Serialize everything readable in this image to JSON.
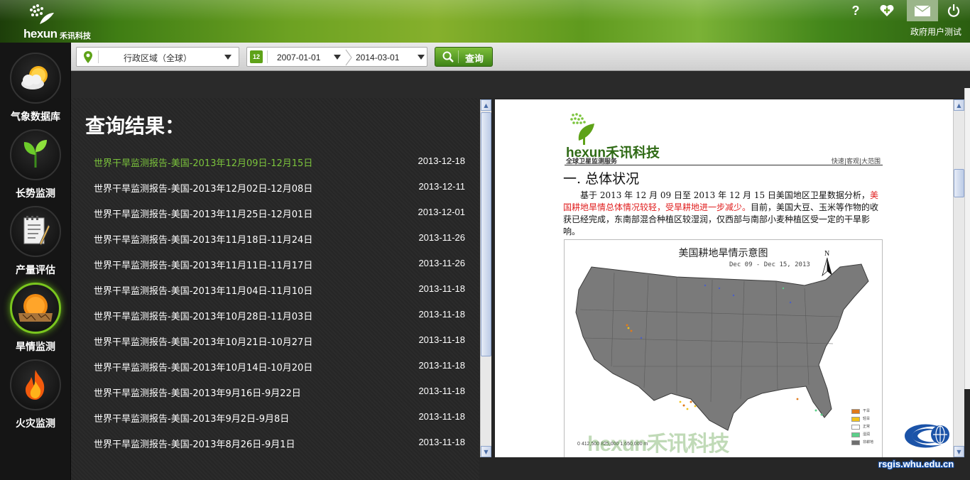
{
  "header": {
    "logo_text": "hexun",
    "logo_cn": "禾讯科技",
    "help_label": "?",
    "username": "政府用户测试"
  },
  "sidebar": {
    "items": [
      {
        "label": "气象数据库",
        "icon": "weather-icon"
      },
      {
        "label": "长势监测",
        "icon": "sprout-icon"
      },
      {
        "label": "产量评估",
        "icon": "notepad-icon"
      },
      {
        "label": "旱情监测",
        "icon": "drought-icon",
        "active": true
      },
      {
        "label": "火灾监测",
        "icon": "fire-icon"
      }
    ]
  },
  "toolbar": {
    "region_value": "行政区域（全球）",
    "start_date": "2007-01-01",
    "end_date": "2014-03-01",
    "calendar_day": "12",
    "query_label": "查询"
  },
  "results": {
    "title": "查询结果：",
    "rows": [
      {
        "title": "世界干旱监测报告-美国-2013年12月09日-12月15日",
        "date": "2013-12-18",
        "selected": true
      },
      {
        "title": "世界干旱监测报告-美国-2013年12月02日-12月08日",
        "date": "2013-12-11"
      },
      {
        "title": "世界干旱监测报告-美国-2013年11月25日-12月01日",
        "date": "2013-12-01"
      },
      {
        "title": "世界干旱监测报告-美国-2013年11月18日-11月24日",
        "date": "2013-11-26"
      },
      {
        "title": "世界干旱监测报告-美国-2013年11月11日-11月17日",
        "date": "2013-11-26"
      },
      {
        "title": "世界干旱监测报告-美国-2013年11月04日-11月10日",
        "date": "2013-11-18"
      },
      {
        "title": "世界干旱监测报告-美国-2013年10月28日-11月03日",
        "date": "2013-11-18"
      },
      {
        "title": "世界干旱监测报告-美国-2013年10月21日-10月27日",
        "date": "2013-11-18"
      },
      {
        "title": "世界干旱监测报告-美国-2013年10月14日-10月20日",
        "date": "2013-11-18"
      },
      {
        "title": "世界干旱监测报告-美国-2013年9月16日-9月22日",
        "date": "2013-11-18"
      },
      {
        "title": "世界干旱监测报告-美国-2013年9月2日-9月8日",
        "date": "2013-11-18"
      },
      {
        "title": "世界干旱监测报告-美国-2013年8月26日-9月1日",
        "date": "2013-11-18"
      }
    ]
  },
  "document": {
    "logo_name": "hexun禾讯科技",
    "service_line": "全球卫星监测服务",
    "tagline": "快速|客观|大范围",
    "heading": "一. 总体状况",
    "para_a": "基于 2013 年 12 月 09 日至 2013 年 12 月 15 日美国地区卫星数据分析，",
    "para_red": "美国耕地旱情总体情况较轻，受旱耕地进一步减少。",
    "para_b": "目前，美国大豆、玉米等作物的收获已经完成，东南部混合种植区较湿润，仅西部与南部小麦种植区受一定的干旱影响。",
    "map_title": "美国耕地旱情示意图",
    "map_date": "Dec 09 - Dec 15, 2013",
    "north_label": "N",
    "legend": [
      {
        "label": "干旱",
        "color": "#e07a1a"
      },
      {
        "label": "轻旱",
        "color": "#f2c21a"
      },
      {
        "label": "正常",
        "color": "#ffffff"
      },
      {
        "label": "湿润",
        "color": "#5cd08a"
      },
      {
        "label": "非耕地",
        "color": "#6e6e6e"
      }
    ],
    "scale_text": "0    412,500   825,000   1,650,000 m",
    "watermark": "hexun禾讯科技"
  },
  "badge": {
    "text": "rsgis.whu.edu.cn"
  },
  "colors": {
    "accent_green": "#7bc33c",
    "header_green": "#6da222",
    "drought_red": "#e02020"
  }
}
